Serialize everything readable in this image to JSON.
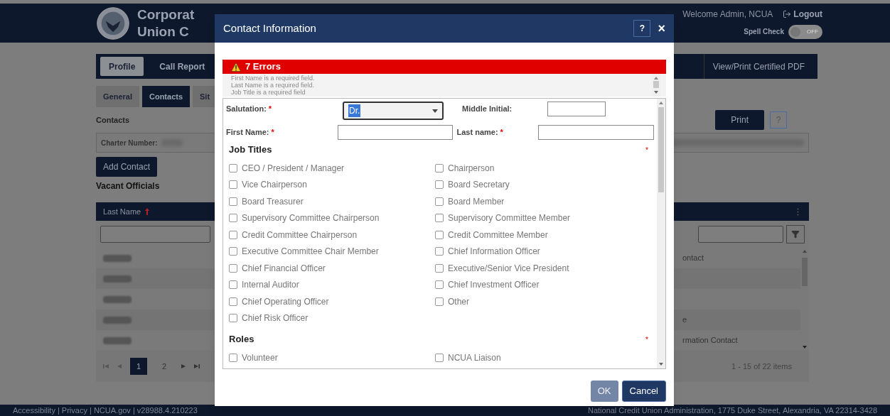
{
  "header": {
    "title_lines": [
      "Corporat",
      "Union C"
    ],
    "welcome": "Welcome Admin, NCUA",
    "logout": "Logout",
    "spell_check": {
      "label": "Spell Check",
      "on": false,
      "state_label": "OFF"
    }
  },
  "main_tabs": [
    {
      "label": "Profile",
      "selected": true
    },
    {
      "label": "Call Report",
      "selected": false
    }
  ],
  "certified_pdf_button": "View/Print Certified PDF",
  "sub_tabs": [
    {
      "label": "General",
      "selected": false
    },
    {
      "label": "Contacts",
      "selected": true
    },
    {
      "label": "Sit",
      "selected": false
    }
  ],
  "section_title": "Contacts",
  "print_button": "Print",
  "help_button": "?",
  "charter_label": "Charter Number:",
  "add_contact_button": "Add Contact",
  "vacant_officials": "Vacant Officials",
  "grid": {
    "column_1": "Last Name",
    "visible_cells": [
      "ontact",
      "",
      "",
      "e",
      "rmation Contact"
    ],
    "pages": [
      {
        "label": "1",
        "selected": true
      },
      {
        "label": "2",
        "selected": false
      }
    ],
    "summary": "1 - 15 of 22 items"
  },
  "footer": {
    "links": "Accessibility | Privacy | NCUA.gov | v28988.4.210223",
    "address": "National Credit Union Administration, 1775 Duke Street, Alexandria, VA 22314-3428"
  },
  "dialog": {
    "title": "Contact Information",
    "help": "?",
    "close": "×",
    "errors": {
      "heading": "7 Errors",
      "messages": [
        "First Name is a required field.",
        "Last Name is a required field.",
        "Job Title is a required field"
      ]
    },
    "fields": {
      "salutation": {
        "label": "Salutation:",
        "required_mark": "*",
        "value": "Dr."
      },
      "middle_initial": {
        "label": "Middle Initial:"
      },
      "first_name": {
        "label": "First Name:",
        "required_mark": "*"
      },
      "last_name": {
        "label": "Last name:",
        "required_mark": "*"
      }
    },
    "sections": [
      {
        "heading": "Job Titles",
        "required_mark": "*",
        "columns": [
          [
            {
              "label": "CEO / President / Manager",
              "checked": false
            },
            {
              "label": "Vice Chairperson",
              "checked": false
            },
            {
              "label": "Board Treasurer",
              "checked": false
            },
            {
              "label": "Supervisory Committee Chairperson",
              "checked": false
            },
            {
              "label": "Credit Committee Chairperson",
              "checked": false
            },
            {
              "label": "Executive Committee Chair Member",
              "checked": false
            },
            {
              "label": "Chief Financial Officer",
              "checked": false
            },
            {
              "label": "Internal Auditor",
              "checked": false
            },
            {
              "label": "Chief Operating Officer",
              "checked": false
            },
            {
              "label": "Chief Risk Officer",
              "checked": false
            }
          ],
          [
            {
              "label": "Chairperson",
              "checked": false
            },
            {
              "label": "Board Secretary",
              "checked": false
            },
            {
              "label": "Board Member",
              "checked": false
            },
            {
              "label": "Supervisory Committee Member",
              "checked": false
            },
            {
              "label": "Credit Committee Member",
              "checked": false
            },
            {
              "label": "Chief Information Officer",
              "checked": false
            },
            {
              "label": "Executive/Senior Vice President",
              "checked": false
            },
            {
              "label": "Chief Investment Officer",
              "checked": false
            },
            {
              "label": "Other",
              "checked": false
            }
          ]
        ]
      },
      {
        "heading": "Roles",
        "required_mark": "*",
        "columns": [
          [
            {
              "label": "Volunteer",
              "checked": false
            }
          ],
          [
            {
              "label": "NCUA Liaison",
              "checked": false
            }
          ]
        ]
      }
    ],
    "buttons": [
      {
        "label": "OK",
        "disabled": true
      },
      {
        "label": "Cancel",
        "disabled": false
      }
    ]
  }
}
